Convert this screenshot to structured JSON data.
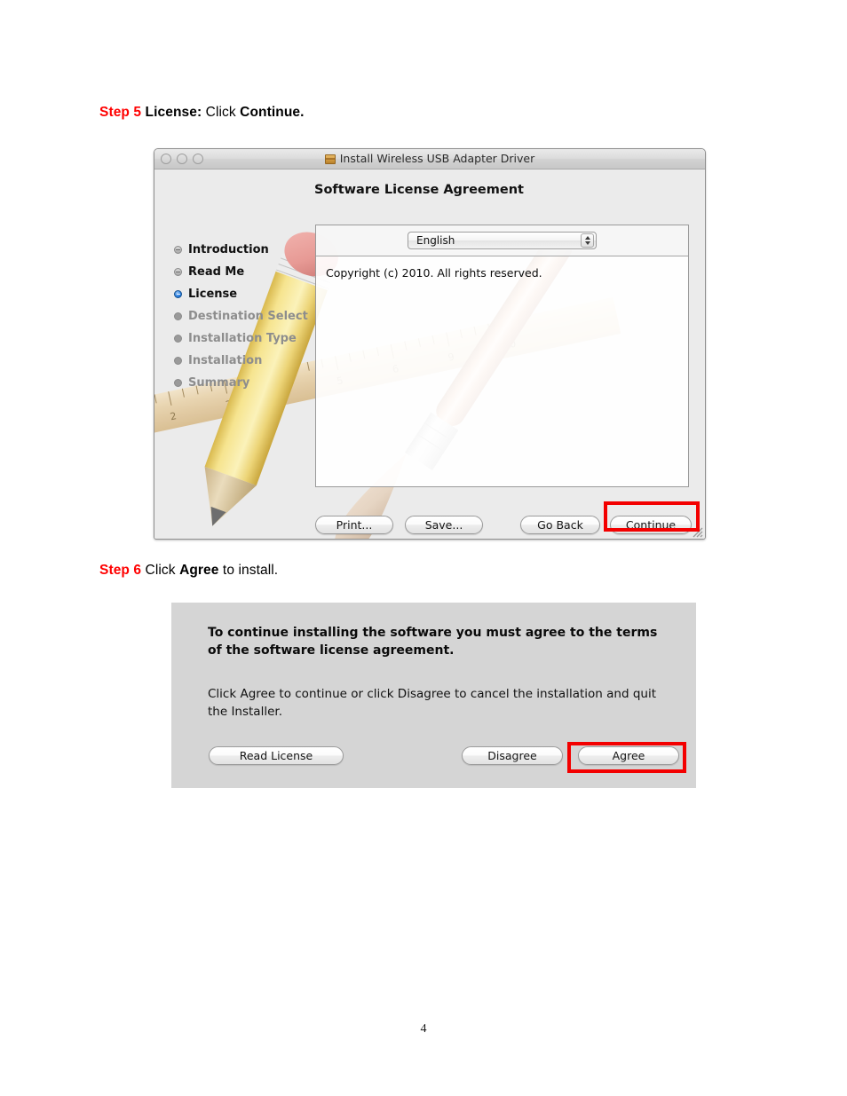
{
  "document": {
    "page_number": "4"
  },
  "steps": [
    {
      "id": "step5",
      "label": "Step 5",
      "title": "License:",
      "action_prefix": "Click",
      "action_target": "Continue."
    },
    {
      "id": "step6",
      "label": "Step 6",
      "title": "",
      "action_prefix": "Click",
      "action_target": "Agree",
      "action_suffix": "to install."
    }
  ],
  "installer_window": {
    "title": "Install Wireless USB Adapter Driver",
    "title_icon": "installer-box-icon",
    "traffic_lights": [
      "close",
      "minimize",
      "zoom"
    ],
    "headline": "Software License Agreement",
    "sidebar": {
      "items": [
        {
          "label": "Introduction",
          "state": "done"
        },
        {
          "label": "Read Me",
          "state": "done"
        },
        {
          "label": "License",
          "state": "current"
        },
        {
          "label": "Destination Select",
          "state": "pending"
        },
        {
          "label": "Installation Type",
          "state": "pending"
        },
        {
          "label": "Installation",
          "state": "pending"
        },
        {
          "label": "Summary",
          "state": "pending"
        }
      ]
    },
    "language_select": {
      "value": "English",
      "options": [
        "English"
      ],
      "stepper_icon": "up-down-stepper-icon"
    },
    "license_text": "Copyright (c) 2010.  All rights reserved.",
    "buttons": {
      "print": "Print...",
      "save": "Save...",
      "go_back": "Go Back",
      "continue": "Continue"
    },
    "highlight_color": "#f30000",
    "highlighted_button": "Continue",
    "background_art": "pencil-ruler-paintbrush-illustration"
  },
  "agreement_dialog": {
    "paragraph_1": "To continue installing the software you must agree to the terms of the software license agreement.",
    "paragraph_2": "Click Agree to continue or click Disagree to cancel the installation and quit the Installer.",
    "buttons": {
      "read_license": "Read License",
      "disagree": "Disagree",
      "agree": "Agree"
    },
    "highlight_color": "#f30000",
    "highlighted_button": "Agree",
    "background_color": "#d5d5d5"
  }
}
